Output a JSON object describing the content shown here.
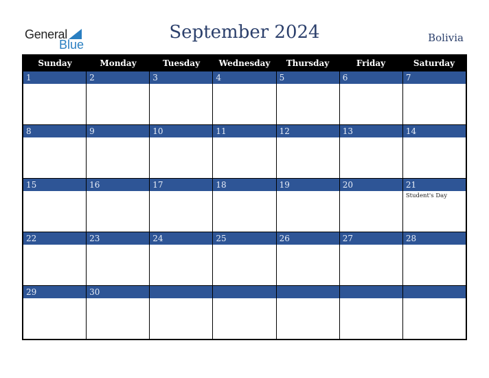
{
  "logo": {
    "line1": "General",
    "line2": "Blue"
  },
  "title": "September 2024",
  "country": "Bolivia",
  "colors": {
    "header_bg": "#000000",
    "band": "#2e5596",
    "title": "#2b3f6b",
    "logo_blue": "#2a7fc1"
  },
  "weekdays": [
    "Sunday",
    "Monday",
    "Tuesday",
    "Wednesday",
    "Thursday",
    "Friday",
    "Saturday"
  ],
  "weeks": [
    [
      {
        "day": "1",
        "event": ""
      },
      {
        "day": "2",
        "event": ""
      },
      {
        "day": "3",
        "event": ""
      },
      {
        "day": "4",
        "event": ""
      },
      {
        "day": "5",
        "event": ""
      },
      {
        "day": "6",
        "event": ""
      },
      {
        "day": "7",
        "event": ""
      }
    ],
    [
      {
        "day": "8",
        "event": ""
      },
      {
        "day": "9",
        "event": ""
      },
      {
        "day": "10",
        "event": ""
      },
      {
        "day": "11",
        "event": ""
      },
      {
        "day": "12",
        "event": ""
      },
      {
        "day": "13",
        "event": ""
      },
      {
        "day": "14",
        "event": ""
      }
    ],
    [
      {
        "day": "15",
        "event": ""
      },
      {
        "day": "16",
        "event": ""
      },
      {
        "day": "17",
        "event": ""
      },
      {
        "day": "18",
        "event": ""
      },
      {
        "day": "19",
        "event": ""
      },
      {
        "day": "20",
        "event": ""
      },
      {
        "day": "21",
        "event": "Student's Day"
      }
    ],
    [
      {
        "day": "22",
        "event": ""
      },
      {
        "day": "23",
        "event": ""
      },
      {
        "day": "24",
        "event": ""
      },
      {
        "day": "25",
        "event": ""
      },
      {
        "day": "26",
        "event": ""
      },
      {
        "day": "27",
        "event": ""
      },
      {
        "day": "28",
        "event": ""
      }
    ],
    [
      {
        "day": "29",
        "event": ""
      },
      {
        "day": "30",
        "event": ""
      },
      {
        "day": "",
        "event": ""
      },
      {
        "day": "",
        "event": ""
      },
      {
        "day": "",
        "event": ""
      },
      {
        "day": "",
        "event": ""
      },
      {
        "day": "",
        "event": ""
      }
    ]
  ]
}
